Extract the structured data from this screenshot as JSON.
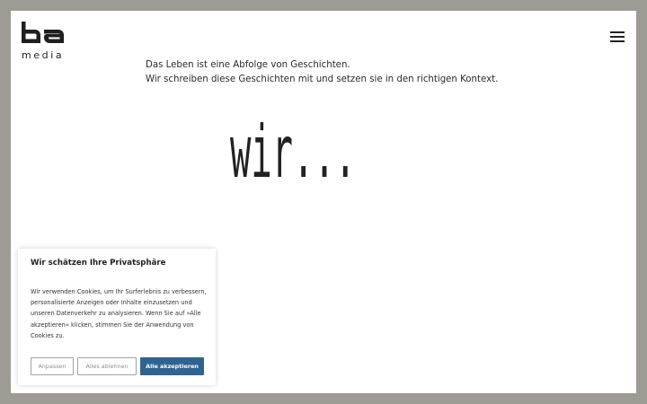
{
  "header": {
    "logo_mark": "ba",
    "logo_text": "media",
    "menu_icon": "hamburger-menu-icon"
  },
  "intro": {
    "line1": "Das Leben ist eine Abfolge von Geschichten.",
    "line2": "Wir schreiben diese Geschichten mit und setzen sie in den richtigen Kontext."
  },
  "hero": {
    "word": "wir..."
  },
  "cookie_banner": {
    "title": "Wir schätzen Ihre Privatsphäre",
    "body": "Wir verwenden Cookies, um Ihr Surferlebnis zu verbessern, personalisierte Anzeigen oder Inhalte einzusetzen und unseren Datenverkehr zu analysieren. Wenn Sie auf »Alle akzeptieren« klicken, stimmen Sie der Anwendung von Cookies zu.",
    "customize_label": "Anpassen",
    "reject_label": "Alles ablehnen",
    "accept_label": "Alle akzeptieren"
  },
  "colors": {
    "frame": "#9e9b94",
    "page": "#ffffff",
    "accent": "#2f6491",
    "text": "#1f1f1f"
  }
}
